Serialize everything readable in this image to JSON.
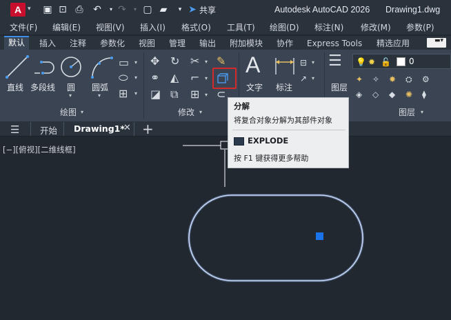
{
  "titlebar": {
    "app_logo": "A",
    "share_label": "共享",
    "app_name": "Autodesk AutoCAD 2026",
    "file_name": "Drawing1.dwg"
  },
  "menu": [
    "文件(F)",
    "编辑(E)",
    "视图(V)",
    "插入(I)",
    "格式(O)",
    "工具(T)",
    "绘图(D)",
    "标注(N)",
    "修改(M)",
    "参数(P)"
  ],
  "ribbon_tabs": [
    "默认",
    "插入",
    "注释",
    "参数化",
    "视图",
    "管理",
    "输出",
    "附加模块",
    "协作",
    "Express Tools",
    "精选应用"
  ],
  "draw_panel": {
    "title": "绘图",
    "line": "直线",
    "polyline": "多段线",
    "circle": "圆",
    "arc": "圆弧"
  },
  "modify_panel": {
    "title": "修改"
  },
  "annotation": {
    "text": "文字",
    "dimension": "标注"
  },
  "layers_panel": {
    "title": "图层",
    "layer_label": "图层",
    "current_layer": "0"
  },
  "file_tabs": {
    "start": "开始",
    "drawing": "Drawing1*"
  },
  "viewport_label": "[−][俯视][二维线框]",
  "tooltip": {
    "title": "分解",
    "description": "将复合对象分解为其部件对象",
    "command": "EXPLODE",
    "help": "按 F1 键获得更多帮助"
  },
  "colors": {
    "selection_outline": "#8fb0ea",
    "grip": "#1a73e8",
    "highlight": "#d42a2a",
    "active_tab_accent": "#3d8ee6"
  },
  "icons": {
    "ucs": "crosshair-icon"
  }
}
